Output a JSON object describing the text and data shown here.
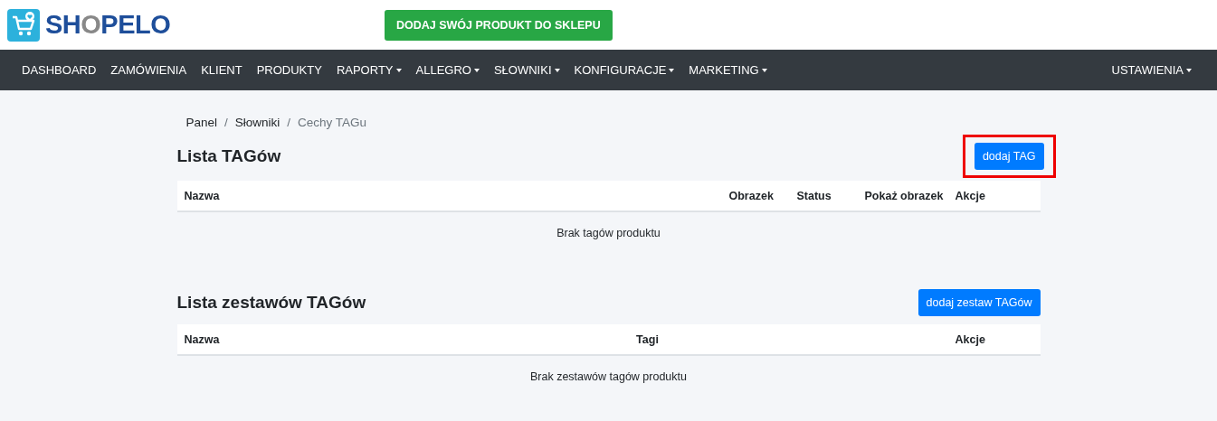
{
  "logo": [
    {
      "text": "SH",
      "kind": "primary"
    },
    {
      "text": "O",
      "kind": "accent"
    },
    {
      "text": "PELO",
      "kind": "primary"
    }
  ],
  "add_product_button": "DODAJ SWÓJ PRODUKT DO SKLEPU",
  "nav": {
    "items": [
      {
        "label": "DASHBOARD",
        "dropdown": false
      },
      {
        "label": "ZAMÓWIENIA",
        "dropdown": false
      },
      {
        "label": "KLIENT",
        "dropdown": false
      },
      {
        "label": "PRODUKTY",
        "dropdown": false
      },
      {
        "label": "RAPORTY",
        "dropdown": true
      },
      {
        "label": "ALLEGRO",
        "dropdown": true
      },
      {
        "label": "SŁOWNIKI",
        "dropdown": true
      },
      {
        "label": "KONFIGURACJE",
        "dropdown": true
      },
      {
        "label": "MARKETING",
        "dropdown": true
      }
    ],
    "right": {
      "label": "USTAWIENIA",
      "dropdown": true
    }
  },
  "breadcrumb_separator": "/",
  "breadcrumb": [
    {
      "label": "Panel",
      "current": false
    },
    {
      "label": "Słowniki",
      "current": false
    },
    {
      "label": "Cechy TAGu",
      "current": true
    }
  ],
  "sections": [
    {
      "kind": "tags",
      "title": "Lista TAGów",
      "button": {
        "label": "dodaj TAG",
        "highlighted": true
      },
      "columns": [
        "Nazwa",
        "Obrazek",
        "Status",
        "Pokaż obrazek",
        "Akcje"
      ],
      "empty": "Brak tagów produktu"
    },
    {
      "kind": "sets",
      "title": "Lista zestawów TAGów",
      "button": {
        "label": "dodaj zestaw TAGów",
        "highlighted": false
      },
      "columns": [
        "Nazwa",
        "Tagi",
        "Akcje"
      ],
      "empty": "Brak zestawów tagów produktu"
    }
  ]
}
